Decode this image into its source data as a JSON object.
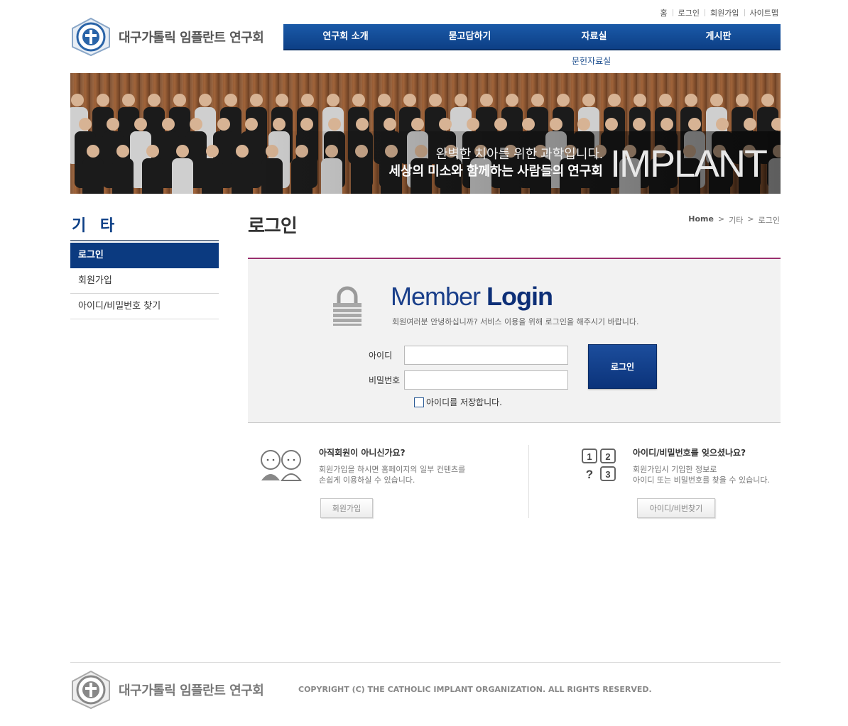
{
  "header": {
    "logo_text": "대구가톨릭 임플란트 연구회",
    "util_links": [
      "홈",
      "로그인",
      "회원가입",
      "사이트맵"
    ],
    "gnb": [
      "연구회 소개",
      "묻고답하기",
      "자료실",
      "게시판"
    ],
    "subnav_item": "문헌자료실"
  },
  "banner": {
    "line1": "완벽한 치아를 위한 과학입니다.",
    "line2": "세상의 미소와 함께하는 사람들의 연구회",
    "brand": "IMPLANT"
  },
  "sidebar": {
    "title": "기 타",
    "items": [
      {
        "label": "로그인",
        "active": true
      },
      {
        "label": "회원가입",
        "active": false
      },
      {
        "label": "아이디/비밀번호 찾기",
        "active": false
      }
    ]
  },
  "content": {
    "page_title": "로그인",
    "breadcrumb": [
      "Home",
      ">",
      "기타",
      ">",
      "로그인"
    ]
  },
  "login": {
    "title_light": "Member",
    "title_bold": "Login",
    "greeting": "회원여러분 안녕하십니까? 서비스 이용을 위해 로그인을 해주시기 바랍니다.",
    "id_label": "아이디",
    "pw_label": "비밀번호",
    "id_value": "",
    "pw_value": "",
    "button": "로그인",
    "remember_label": "아이디를 저장합니다.",
    "remember_checked": false
  },
  "join_block": {
    "title": "아직회원이 아니신가요?",
    "desc_line1": "회원가입을 하시면 홈페이지의 일부 컨텐츠를",
    "desc_line2": "손쉽게 이용하실 수 있습니다.",
    "button": "회원가입"
  },
  "find_block": {
    "title": "아이디/비밀번호를 잊으셨나요?",
    "desc_line1": "회원가입시 기입한 정보로",
    "desc_line2": "아이디 또는 비밀번호를 찾을 수 있습니다.",
    "button": "아이디/비번찾기",
    "icon_digits": [
      "1",
      "2",
      "?",
      "3"
    ]
  },
  "footer": {
    "logo_text": "대구가톨릭 임플란트 연구회",
    "copyright": "COPYRIGHT (C) THE CATHOLIC IMPLANT ORGANIZATION. ALL RIGHTS RESERVED."
  },
  "colors": {
    "primary_navy": "#0b3a80",
    "accent_rule": "#9a2f6e",
    "login_bg": "#f2f2f2"
  }
}
